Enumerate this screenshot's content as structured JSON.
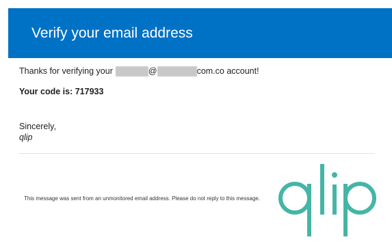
{
  "header": {
    "title": "Verify your email address",
    "background_color": "#0072c6"
  },
  "body": {
    "thanks_prefix": "Thanks for verifying your",
    "at_symbol": "@",
    "thanks_suffix": "com.co account!",
    "code_text": "Your code is: 717933",
    "closing": "Sincerely,",
    "signature": "qlip"
  },
  "footer": {
    "notice": "This message was sent from an unmonitored email address. Please do not reply to this message."
  },
  "logo": {
    "text": "qlip",
    "color": "#45b5a6"
  }
}
